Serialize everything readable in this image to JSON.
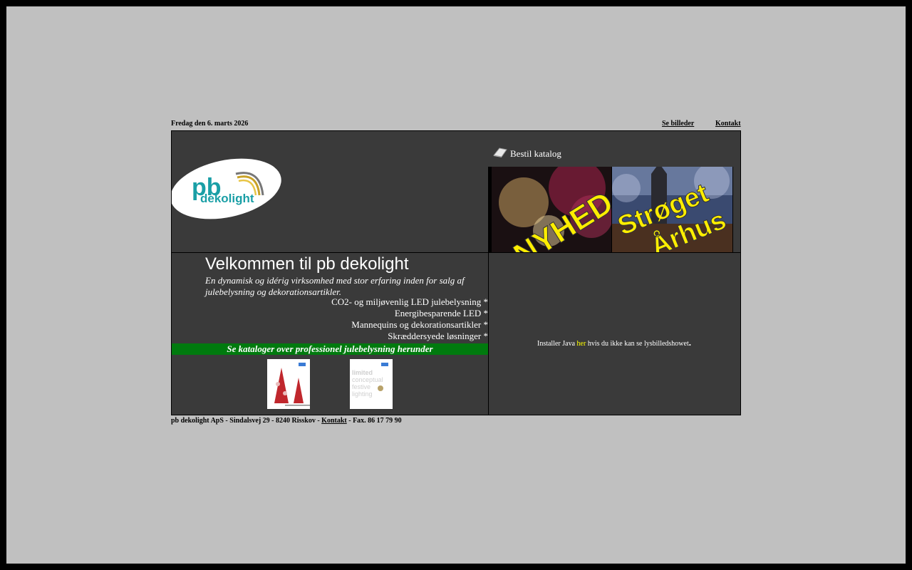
{
  "topbar": {
    "date": "Fredag den 6. marts 2026",
    "see_pictures": "Se billeder",
    "contact": "Kontakt"
  },
  "header": {
    "order_catalog": "Bestil katalog",
    "banner_left_text": "NYHED",
    "banner_right_text_1": "Strøget",
    "banner_right_text_2": "Århus"
  },
  "logo": {
    "line1": "pb",
    "line2": "dekolight"
  },
  "welcome": {
    "title": "Velkommen til pb dekolight",
    "intro": "En dynamisk og idérig virksomhed med stor erfaring inden for salg af julebelysning og dekorationsartikler."
  },
  "features": [
    "CO2- og miljøvenlig LED julebelysning *",
    "Energibesparende LED *",
    "Mannequins og dekorationsartikler *",
    "Skræddersyede løsninger *"
  ],
  "catalogs_heading": "Se kataloger over professionel julebelysning herunder",
  "catalog2_text": [
    "limited",
    "conceptual",
    "festive",
    "lighting"
  ],
  "java": {
    "prefix": "Installer Java ",
    "link": "her",
    "suffix": " hvis du ikke kan se lysbilledshowet",
    "dot": "."
  },
  "footer": {
    "prefix": "pb dekolight ApS - Sindalsvej 29 - 8240 Risskov - ",
    "contact": "Kontakt",
    "suffix": " - Fax. 86 17 79 90"
  },
  "colors": {
    "page_bg": "#c0c0c0",
    "panel_bg": "#3a3a3a",
    "green_bar": "#007a0e",
    "java_link": "#ffff00",
    "logo_teal": "#1a9fa6"
  }
}
